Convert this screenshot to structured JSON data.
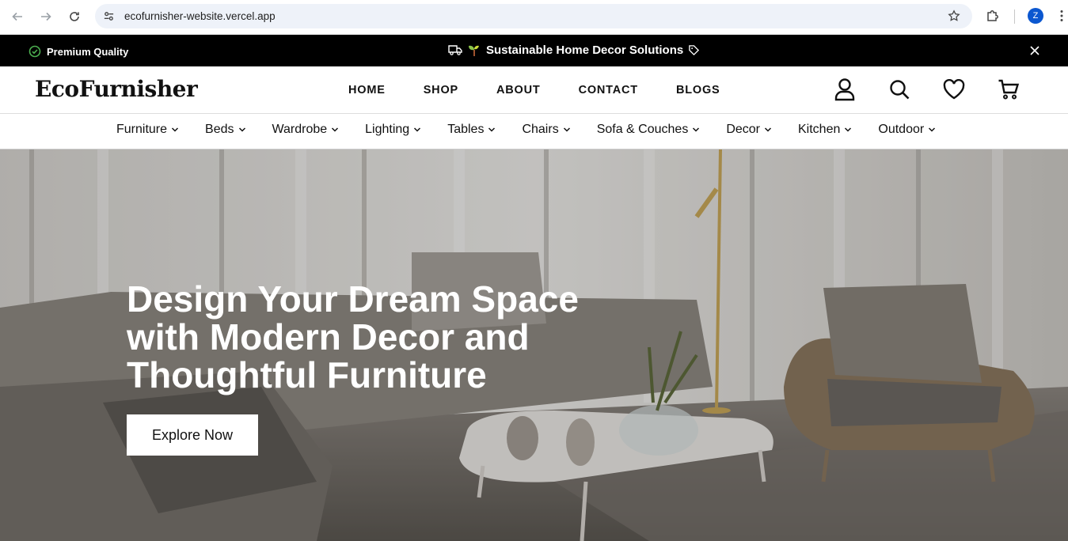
{
  "browser": {
    "url": "ecofurnisher-website.vercel.app",
    "profile_initial": "Z",
    "accent": "#0b57d0"
  },
  "announcement": {
    "left_text": "Premium Quality",
    "center_text": "Sustainable Home Decor Solutions",
    "check_color": "#4caf50",
    "sprout_color": "#8bc34a"
  },
  "header": {
    "logo": "EcoFurnisher",
    "nav": [
      {
        "label": "HOME"
      },
      {
        "label": "SHOP"
      },
      {
        "label": "ABOUT"
      },
      {
        "label": "CONTACT"
      },
      {
        "label": "BLOGS"
      }
    ],
    "icons": [
      "user-icon",
      "search-icon",
      "heart-icon",
      "cart-icon"
    ]
  },
  "categories": [
    {
      "label": "Furniture"
    },
    {
      "label": "Beds"
    },
    {
      "label": "Wardrobe"
    },
    {
      "label": "Lighting"
    },
    {
      "label": "Tables"
    },
    {
      "label": "Chairs"
    },
    {
      "label": "Sofa & Couches"
    },
    {
      "label": "Decor"
    },
    {
      "label": "Kitchen"
    },
    {
      "label": "Outdoor"
    }
  ],
  "hero": {
    "title_lines": [
      "Design Your Dream Space",
      "with Modern Decor and",
      "Thoughtful Furniture"
    ],
    "cta_label": "Explore Now"
  }
}
